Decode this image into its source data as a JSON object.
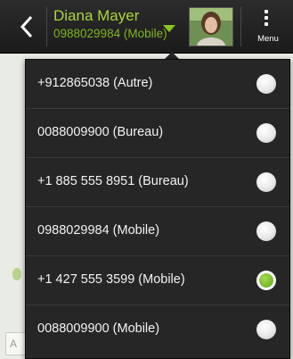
{
  "header": {
    "contact_name": "Diana Mayer",
    "contact_number": "0988029984 (Mobile)",
    "menu_label": "Menu"
  },
  "background": {
    "input_letter": "A"
  },
  "phone_list": {
    "items": [
      {
        "label": "+912865038 (Autre)",
        "selected": false
      },
      {
        "label": "0088009900 (Bureau)",
        "selected": false
      },
      {
        "label": "+1 885 555 8951 (Bureau)",
        "selected": false
      },
      {
        "label": "0988029984 (Mobile)",
        "selected": false
      },
      {
        "label": "+1 427 555 3599 (Mobile)",
        "selected": true
      },
      {
        "label": "0088009900 (Mobile)",
        "selected": false
      }
    ]
  },
  "colors": {
    "accent_green": "#8bc524",
    "contact_name": "#a7d63a",
    "popup_bg": "#262626"
  }
}
